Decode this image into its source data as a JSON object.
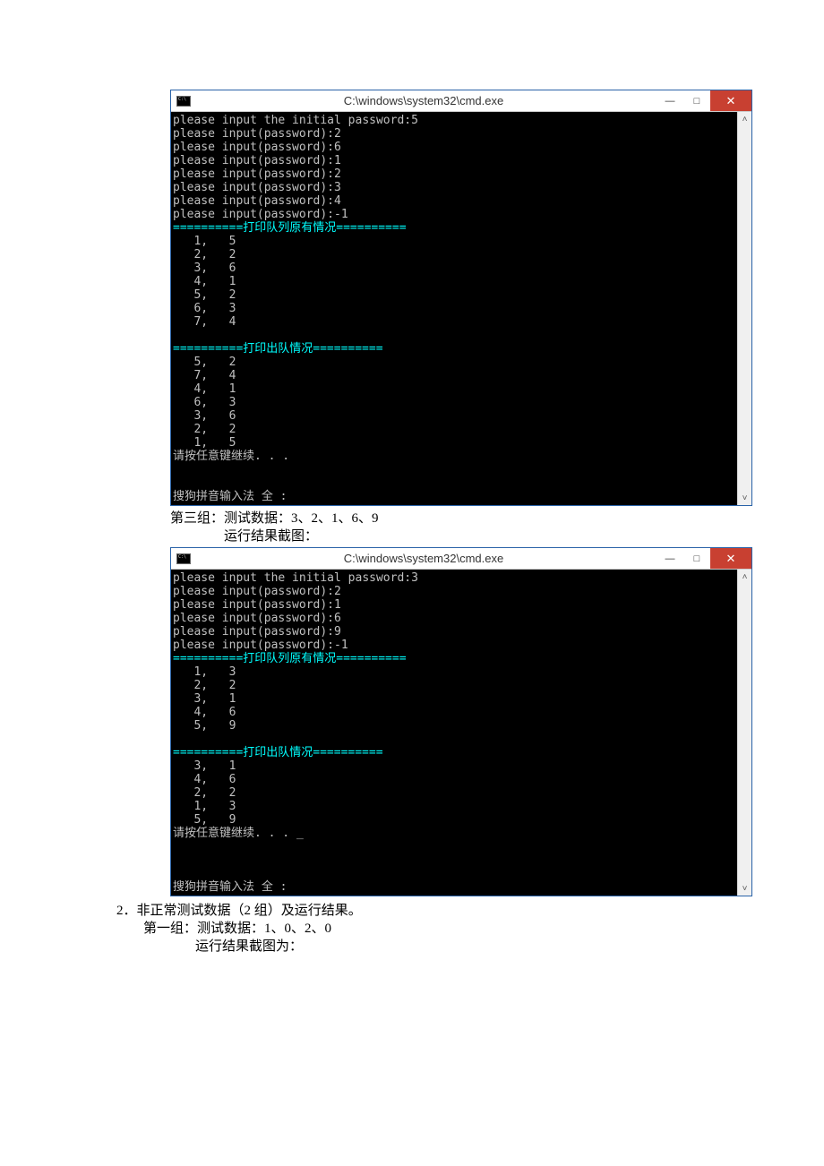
{
  "window1": {
    "title": "C:\\windows\\system32\\cmd.exe",
    "lines": [
      "please input the initial password:5",
      "please input(password):2",
      "please input(password):6",
      "please input(password):1",
      "please input(password):2",
      "please input(password):3",
      "please input(password):4",
      "please input(password):-1"
    ],
    "sep1": "==========打印队列原有情况==========",
    "rows1": [
      "   1,   5",
      "   2,   2",
      "   3,   6",
      "   4,   1",
      "   5,   2",
      "   6,   3",
      "   7,   4"
    ],
    "sep2": "==========打印出队情况==========",
    "rows2": [
      "   5,   2",
      "   7,   4",
      "   4,   1",
      "   6,   3",
      "   3,   6",
      "   2,   2",
      "   1,   5"
    ],
    "cont": "请按任意键继续. . .",
    "ime": "搜狗拼音输入法 全 :"
  },
  "caption1": {
    "line1": "第三组：测试数据：3、2、1、6、9",
    "line2": "运行结果截图："
  },
  "window2": {
    "title": "C:\\windows\\system32\\cmd.exe",
    "lines": [
      "please input the initial password:3",
      "please input(password):2",
      "please input(password):1",
      "please input(password):6",
      "please input(password):9",
      "please input(password):-1"
    ],
    "sep1": "==========打印队列原有情况==========",
    "rows1": [
      "   1,   3",
      "   2,   2",
      "   3,   1",
      "   4,   6",
      "   5,   9"
    ],
    "sep2": "==========打印出队情况==========",
    "rows2": [
      "   3,   1",
      "   4,   6",
      "   2,   2",
      "   1,   3",
      "   5,   9"
    ],
    "cont": "请按任意键继续. . . _",
    "ime": "搜狗拼音输入法 全 :"
  },
  "section2": {
    "line1": "2．非正常测试数据（2 组）及运行结果。",
    "line2": "第一组：测试数据：1、0、2、0",
    "line3": "运行结果截图为："
  },
  "btns": {
    "min": "—",
    "max": "□",
    "close": "✕",
    "up": "˄",
    "down": "˅"
  }
}
